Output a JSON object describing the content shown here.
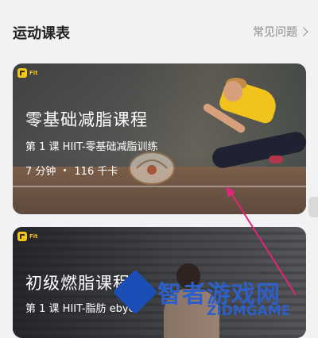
{
  "header": {
    "title": "运动课表",
    "faq_label": "常见问题"
  },
  "cards": [
    {
      "badge": "Fit",
      "title": "零基础减脂课程",
      "lesson": "第 1 课 HIIT-零基础减脂训练",
      "duration": "7 分钟",
      "calories": "116 千卡"
    },
    {
      "badge": "Fit",
      "title": "初级燃脂课程",
      "lesson": "第 1 课 HIIT-脂肪 ebye",
      "duration": "",
      "calories": ""
    }
  ],
  "watermark": {
    "text": "智者游戏网",
    "sub": "ZIDMGAME"
  },
  "colors": {
    "arrow": "#e0267a",
    "badge_yellow": "#f5c518",
    "watermark_blue": "#2d5fc8"
  }
}
